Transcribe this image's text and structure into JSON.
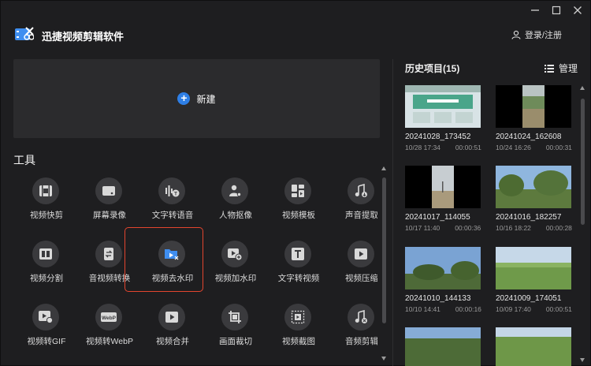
{
  "app": {
    "title": "迅捷视频剪辑软件",
    "login_label": "登录/注册",
    "accent": "#2e7fe6",
    "highlight": "#e3452e"
  },
  "window_controls": [
    "minimize-icon",
    "maximize-icon",
    "close-icon"
  ],
  "new_project": {
    "label": "新建",
    "icon": "plus-circle-icon"
  },
  "tools": {
    "title": "工具",
    "items": [
      {
        "label": "视频快剪",
        "icon": "film-icon"
      },
      {
        "label": "屏幕录像",
        "icon": "screen-record-icon"
      },
      {
        "label": "文字转语音",
        "icon": "text-to-speech-icon"
      },
      {
        "label": "人物抠像",
        "icon": "person-cutout-icon"
      },
      {
        "label": "视频模板",
        "icon": "template-icon"
      },
      {
        "label": "声音提取",
        "icon": "music-extract-icon"
      },
      {
        "label": "视频分割",
        "icon": "split-icon"
      },
      {
        "label": "音视频转换",
        "icon": "convert-icon"
      },
      {
        "label": "视频去水印",
        "icon": "remove-watermark-icon"
      },
      {
        "label": "视频加水印",
        "icon": "add-watermark-icon"
      },
      {
        "label": "文字转视频",
        "icon": "text-to-video-icon"
      },
      {
        "label": "视频压缩",
        "icon": "compress-icon"
      },
      {
        "label": "视频转GIF",
        "icon": "gif-icon"
      },
      {
        "label": "视频转WebP",
        "icon": "webp-icon"
      },
      {
        "label": "视频合并",
        "icon": "merge-icon"
      },
      {
        "label": "画面裁切",
        "icon": "crop-icon"
      },
      {
        "label": "视频截图",
        "icon": "screenshot-icon"
      },
      {
        "label": "音频剪辑",
        "icon": "audio-edit-icon"
      }
    ]
  },
  "history": {
    "title": "历史项目(15)",
    "manage_label": "管理",
    "items": [
      {
        "name": "20241028_173452",
        "time": "10/28 17:34",
        "duration": "00:00:51",
        "thumb": "screen"
      },
      {
        "name": "20241024_162608",
        "time": "10/24 16:26",
        "duration": "00:00:31",
        "thumb": "portrait"
      },
      {
        "name": "20241017_114055",
        "time": "10/17 11:40",
        "duration": "00:00:36",
        "thumb": "portrait"
      },
      {
        "name": "20241016_182257",
        "time": "10/16 18:22",
        "duration": "00:00:28",
        "thumb": "trees"
      },
      {
        "name": "20241010_144133",
        "time": "10/10 14:41",
        "duration": "00:00:16",
        "thumb": "sky"
      },
      {
        "name": "20241009_174051",
        "time": "10/09 17:40",
        "duration": "00:00:51",
        "thumb": "field"
      },
      {
        "thumb": "sky"
      },
      {
        "thumb": "field"
      }
    ]
  }
}
